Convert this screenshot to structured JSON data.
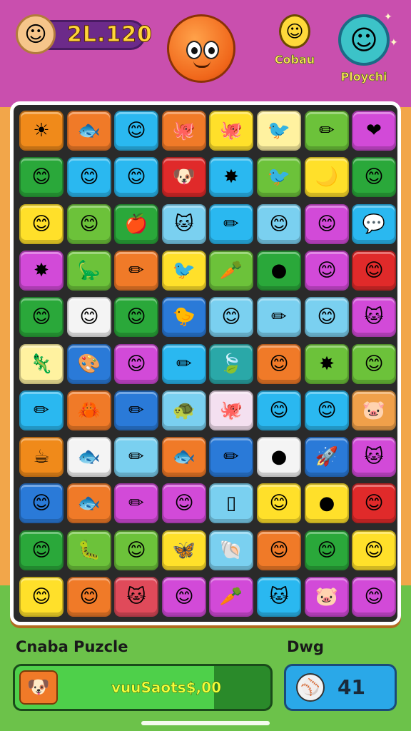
{
  "header": {
    "score": "2L.120",
    "player1_name": "Cobau",
    "player2_name": "Ploychi",
    "avatar_icon": "smiley-face-icon",
    "mascot_icon": "orange-blob-icon"
  },
  "board": {
    "rows": 11,
    "cols": 8,
    "tiles": [
      [
        [
          "#f08a1a",
          "☀"
        ],
        [
          "#f07a28",
          "🐟"
        ],
        [
          "#2ab8f0",
          "😊"
        ],
        [
          "#f07a28",
          "🐙"
        ],
        [
          "#ffe02a",
          "🐙"
        ],
        [
          "#fff2a0",
          "🐦"
        ],
        [
          "#6cc23a",
          "✏"
        ],
        [
          "#d24ad8",
          "❤"
        ]
      ],
      [
        [
          "#2aa83a",
          "😊"
        ],
        [
          "#2ab8f0",
          "😊"
        ],
        [
          "#2ab8f0",
          "😊"
        ],
        [
          "#e02a2a",
          "🐶"
        ],
        [
          "#2ab8f0",
          "✸"
        ],
        [
          "#6cc23a",
          "🐦"
        ],
        [
          "#ffe02a",
          "🌙"
        ],
        [
          "#2aa83a",
          "😊"
        ]
      ],
      [
        [
          "#ffe02a",
          "😊"
        ],
        [
          "#6cc23a",
          "😊"
        ],
        [
          "#2aa83a",
          "🍎"
        ],
        [
          "#7ad0f0",
          "🐱"
        ],
        [
          "#2ab8f0",
          "✏"
        ],
        [
          "#7ad0f0",
          "😊"
        ],
        [
          "#d24ad8",
          "😊"
        ],
        [
          "#2ab8f0",
          "💬"
        ]
      ],
      [
        [
          "#d24ad8",
          "✸"
        ],
        [
          "#6cc23a",
          "🦕"
        ],
        [
          "#f07a28",
          "✏"
        ],
        [
          "#ffe02a",
          "🐦"
        ],
        [
          "#6cc23a",
          "🥕"
        ],
        [
          "#2aa83a",
          "●"
        ],
        [
          "#d24ad8",
          "😊"
        ],
        [
          "#e02a2a",
          "😊"
        ]
      ],
      [
        [
          "#2aa83a",
          "😊"
        ],
        [
          "#f4f4f4",
          "😊"
        ],
        [
          "#2aa83a",
          "😊"
        ],
        [
          "#2a7ad8",
          "🐤"
        ],
        [
          "#7ad0f0",
          "😊"
        ],
        [
          "#7ad0f0",
          "✏"
        ],
        [
          "#7ad0f0",
          "😊"
        ],
        [
          "#d24ad8",
          "🐱"
        ]
      ],
      [
        [
          "#fff2a0",
          "🦎"
        ],
        [
          "#2a7ad8",
          "🎨"
        ],
        [
          "#d24ad8",
          "😊"
        ],
        [
          "#2ab8f0",
          "✏"
        ],
        [
          "#2aa8a8",
          "🍃"
        ],
        [
          "#f07a28",
          "😊"
        ],
        [
          "#6cc23a",
          "✸"
        ],
        [
          "#6cc23a",
          "😊"
        ]
      ],
      [
        [
          "#2ab8f0",
          "✏"
        ],
        [
          "#f07a28",
          "🦀"
        ],
        [
          "#2a7ad8",
          "✏"
        ],
        [
          "#7ad0f0",
          "🐢"
        ],
        [
          "#f4e0f0",
          "🐙"
        ],
        [
          "#2ab8f0",
          "😊"
        ],
        [
          "#2ab8f0",
          "😊"
        ],
        [
          "#f0a04a",
          "🐷"
        ]
      ],
      [
        [
          "#f08a1a",
          "☕"
        ],
        [
          "#f4f4f4",
          "🐟"
        ],
        [
          "#7ad0f0",
          "✏"
        ],
        [
          "#f07a28",
          "🐟"
        ],
        [
          "#2a7ad8",
          "✏"
        ],
        [
          "#f4f4f4",
          "●"
        ],
        [
          "#2a7ad8",
          "🚀"
        ],
        [
          "#d24ad8",
          "🐱"
        ]
      ],
      [
        [
          "#2a7ad8",
          "😊"
        ],
        [
          "#f07a28",
          "🐟"
        ],
        [
          "#d24ad8",
          "✏"
        ],
        [
          "#d24ad8",
          "😊"
        ],
        [
          "#7ad0f0",
          "▯"
        ],
        [
          "#ffe02a",
          "😊"
        ],
        [
          "#ffe02a",
          "●"
        ],
        [
          "#e02a2a",
          "😊"
        ]
      ],
      [
        [
          "#2aa83a",
          "😊"
        ],
        [
          "#6cc23a",
          "🐛"
        ],
        [
          "#6cc23a",
          "😊"
        ],
        [
          "#ffe02a",
          "🦋"
        ],
        [
          "#7ad0f0",
          "🐚"
        ],
        [
          "#f07a28",
          "😊"
        ],
        [
          "#2aa83a",
          "😊"
        ],
        [
          "#ffe02a",
          "😊"
        ]
      ],
      [
        [
          "#ffe02a",
          "😊"
        ],
        [
          "#f07a28",
          "😊"
        ],
        [
          "#e04a5a",
          "🐱"
        ],
        [
          "#d24ad8",
          "😊"
        ],
        [
          "#d24ad8",
          "🥕"
        ],
        [
          "#2ab8f0",
          "🐱"
        ],
        [
          "#d24ad8",
          "🐷"
        ],
        [
          "#d24ad8",
          "😊"
        ]
      ]
    ]
  },
  "footer": {
    "game_title": "Cnaba Puzcle",
    "mode_label": "Dwg",
    "progress_text": "vuuSaots$,00",
    "progress_fraction": 0.78,
    "moves_count": "41",
    "progress_icon": "puzzle-character-icon",
    "moves_icon": "ball-icon"
  }
}
